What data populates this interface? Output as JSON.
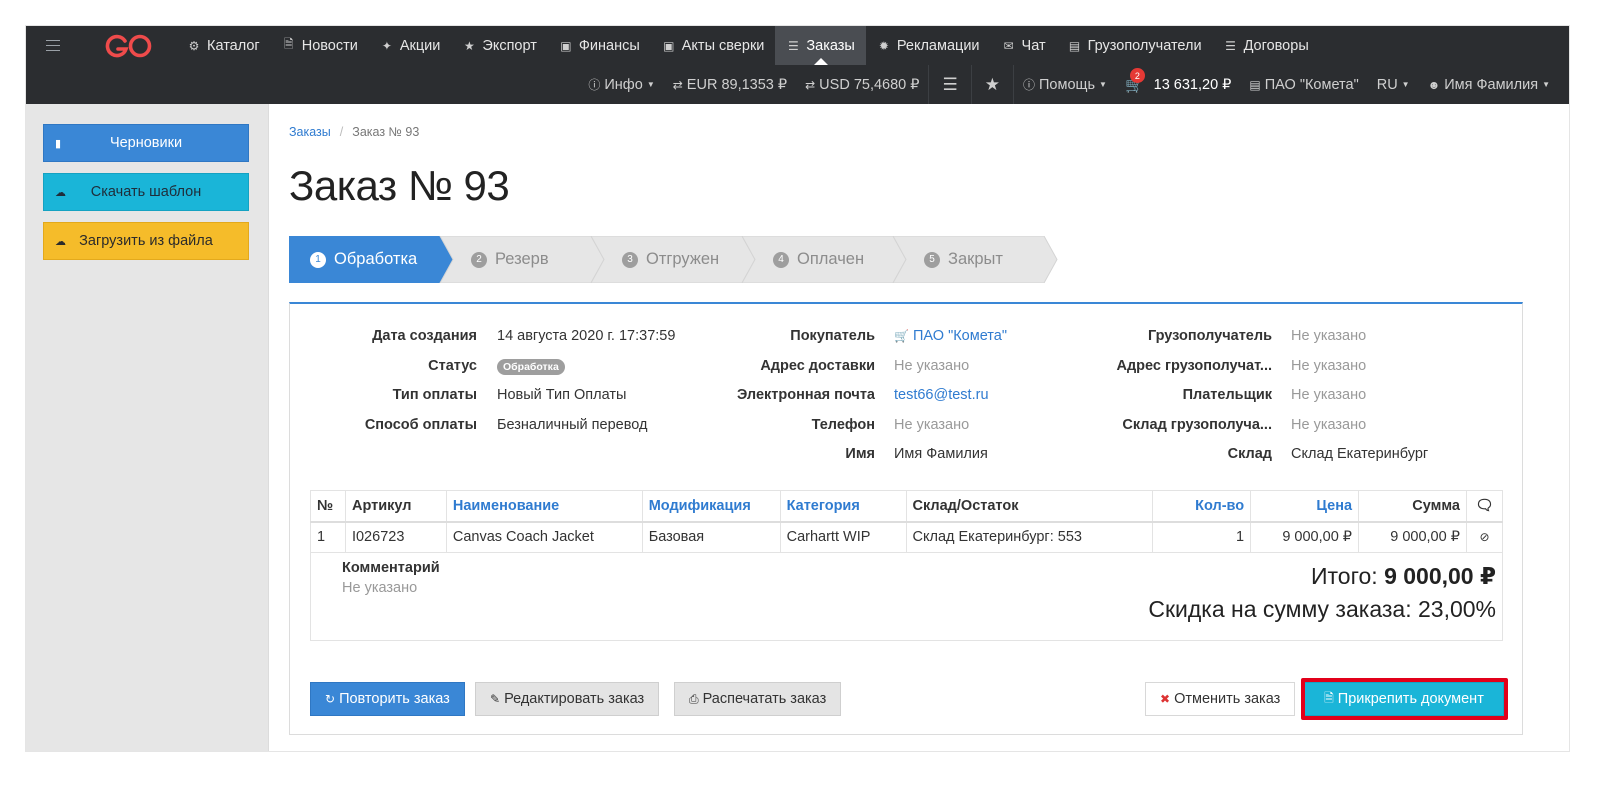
{
  "nav": {
    "items": [
      {
        "label": "Каталог",
        "icon": "sitemap-icon"
      },
      {
        "label": "Новости",
        "icon": "file-icon"
      },
      {
        "label": "Акции",
        "icon": "tag-icon"
      },
      {
        "label": "Экспорт",
        "icon": "star-icon"
      },
      {
        "label": "Финансы",
        "icon": "money-icon"
      },
      {
        "label": "Акты сверки",
        "icon": "money-icon"
      },
      {
        "label": "Заказы",
        "icon": "list-icon",
        "active": true
      },
      {
        "label": "Рекламации",
        "icon": "gear-icon"
      },
      {
        "label": "Чат",
        "icon": "envelope-icon"
      },
      {
        "label": "Грузополучатели",
        "icon": "archive-icon"
      },
      {
        "label": "Договоры",
        "icon": "list-icon"
      }
    ],
    "row2": {
      "info": "Инфо",
      "eur": "EUR 89,1353 ₽",
      "usd": "USD 75,4680 ₽",
      "help": "Помощь",
      "cart_count": "2",
      "cart_total": "13 631,20 ₽",
      "company": "ПАО \"Комета\"",
      "lang": "RU",
      "user": "Имя Фамилия"
    }
  },
  "sidebar": {
    "drafts": "Черновики",
    "download_template": "Скачать шаблон",
    "upload_file": "Загрузить из файла"
  },
  "breadcrumb": {
    "orders": "Заказы",
    "current": "Заказ № 93"
  },
  "page_title": "Заказ № 93",
  "steps": [
    {
      "num": "1",
      "label": "Обработка",
      "active": true
    },
    {
      "num": "2",
      "label": "Резерв"
    },
    {
      "num": "3",
      "label": "Отгружен"
    },
    {
      "num": "4",
      "label": "Оплачен"
    },
    {
      "num": "5",
      "label": "Закрыт"
    }
  ],
  "order": {
    "col1": {
      "created_label": "Дата создания",
      "created_value": "14 августа 2020 г. 17:37:59",
      "status_label": "Статус",
      "status_value": "Обработка",
      "pay_type_label": "Тип оплаты",
      "pay_type_value": "Новый Тип Оплаты",
      "pay_method_label": "Способ оплаты",
      "pay_method_value": "Безналичный перевод"
    },
    "col2": {
      "buyer_label": "Покупатель",
      "buyer_value": "ПАО \"Комета\"",
      "address_label": "Адрес доставки",
      "address_value": "Не указано",
      "email_label": "Электронная почта",
      "email_value": "test66@test.ru",
      "phone_label": "Телефон",
      "phone_value": "Не указано",
      "name_label": "Имя",
      "name_value": "Имя Фамилия"
    },
    "col3": {
      "consignee_label": "Грузополучатель",
      "consignee_value": "Не указано",
      "consignee_addr_label": "Адрес грузополучат...",
      "consignee_addr_value": "Не указано",
      "payer_label": "Плательщик",
      "payer_value": "Не указано",
      "consignee_wh_label": "Склад грузополуча...",
      "consignee_wh_value": "Не указано",
      "warehouse_label": "Склад",
      "warehouse_value": "Склад Екатеринбург"
    }
  },
  "table": {
    "headers": {
      "num": "№",
      "sku": "Артикул",
      "name": "Наименование",
      "mod": "Модификация",
      "cat": "Категория",
      "stock": "Склад/Остаток",
      "qty": "Кол-во",
      "price": "Цена",
      "sum": "Сумма"
    },
    "rows": [
      {
        "num": "1",
        "sku": "I026723",
        "name": "Canvas Coach Jacket",
        "mod": "Базовая",
        "cat": "Carhartt WIP",
        "stock": "Склад Екатеринбург: 553",
        "qty": "1",
        "price": "9 000,00 ₽",
        "sum": "9 000,00 ₽"
      }
    ]
  },
  "summary": {
    "comment_label": "Комментарий",
    "comment_value": "Не указано",
    "total_label": "Итого:",
    "total_value": "9 000,00 ₽",
    "discount": "Скидка на сумму заказа: 23,00%"
  },
  "actions": {
    "repeat": "Повторить заказ",
    "edit": "Редактировать заказ",
    "print": "Распечатать заказ",
    "cancel": "Отменить заказ",
    "attach": "Прикрепить документ"
  },
  "colors": {
    "primary": "#3a87d6",
    "info": "#1ab5d8",
    "warning": "#f5bc2a",
    "navbar": "#2b2d30",
    "highlight": "#e2001a"
  }
}
